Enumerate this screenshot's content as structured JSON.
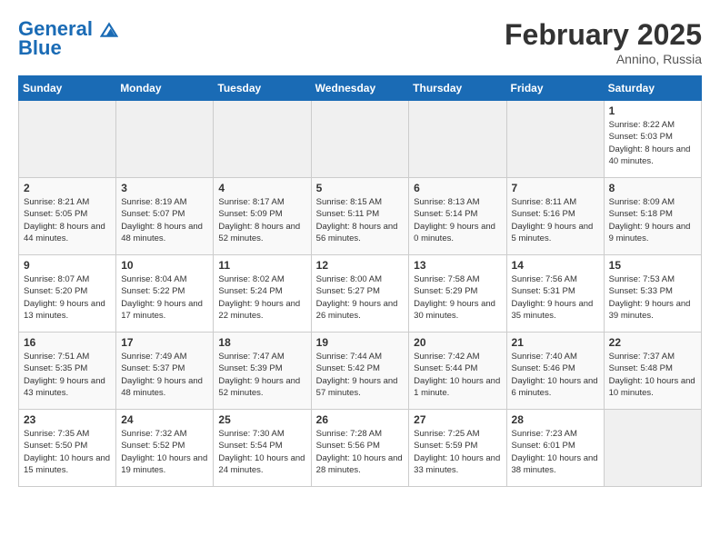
{
  "header": {
    "logo_line1": "General",
    "logo_line2": "Blue",
    "month_title": "February 2025",
    "location": "Annino, Russia"
  },
  "weekdays": [
    "Sunday",
    "Monday",
    "Tuesday",
    "Wednesday",
    "Thursday",
    "Friday",
    "Saturday"
  ],
  "weeks": [
    [
      {
        "day": "",
        "info": ""
      },
      {
        "day": "",
        "info": ""
      },
      {
        "day": "",
        "info": ""
      },
      {
        "day": "",
        "info": ""
      },
      {
        "day": "",
        "info": ""
      },
      {
        "day": "",
        "info": ""
      },
      {
        "day": "1",
        "info": "Sunrise: 8:22 AM\nSunset: 5:03 PM\nDaylight: 8 hours and 40 minutes."
      }
    ],
    [
      {
        "day": "2",
        "info": "Sunrise: 8:21 AM\nSunset: 5:05 PM\nDaylight: 8 hours and 44 minutes."
      },
      {
        "day": "3",
        "info": "Sunrise: 8:19 AM\nSunset: 5:07 PM\nDaylight: 8 hours and 48 minutes."
      },
      {
        "day": "4",
        "info": "Sunrise: 8:17 AM\nSunset: 5:09 PM\nDaylight: 8 hours and 52 minutes."
      },
      {
        "day": "5",
        "info": "Sunrise: 8:15 AM\nSunset: 5:11 PM\nDaylight: 8 hours and 56 minutes."
      },
      {
        "day": "6",
        "info": "Sunrise: 8:13 AM\nSunset: 5:14 PM\nDaylight: 9 hours and 0 minutes."
      },
      {
        "day": "7",
        "info": "Sunrise: 8:11 AM\nSunset: 5:16 PM\nDaylight: 9 hours and 5 minutes."
      },
      {
        "day": "8",
        "info": "Sunrise: 8:09 AM\nSunset: 5:18 PM\nDaylight: 9 hours and 9 minutes."
      }
    ],
    [
      {
        "day": "9",
        "info": "Sunrise: 8:07 AM\nSunset: 5:20 PM\nDaylight: 9 hours and 13 minutes."
      },
      {
        "day": "10",
        "info": "Sunrise: 8:04 AM\nSunset: 5:22 PM\nDaylight: 9 hours and 17 minutes."
      },
      {
        "day": "11",
        "info": "Sunrise: 8:02 AM\nSunset: 5:24 PM\nDaylight: 9 hours and 22 minutes."
      },
      {
        "day": "12",
        "info": "Sunrise: 8:00 AM\nSunset: 5:27 PM\nDaylight: 9 hours and 26 minutes."
      },
      {
        "day": "13",
        "info": "Sunrise: 7:58 AM\nSunset: 5:29 PM\nDaylight: 9 hours and 30 minutes."
      },
      {
        "day": "14",
        "info": "Sunrise: 7:56 AM\nSunset: 5:31 PM\nDaylight: 9 hours and 35 minutes."
      },
      {
        "day": "15",
        "info": "Sunrise: 7:53 AM\nSunset: 5:33 PM\nDaylight: 9 hours and 39 minutes."
      }
    ],
    [
      {
        "day": "16",
        "info": "Sunrise: 7:51 AM\nSunset: 5:35 PM\nDaylight: 9 hours and 43 minutes."
      },
      {
        "day": "17",
        "info": "Sunrise: 7:49 AM\nSunset: 5:37 PM\nDaylight: 9 hours and 48 minutes."
      },
      {
        "day": "18",
        "info": "Sunrise: 7:47 AM\nSunset: 5:39 PM\nDaylight: 9 hours and 52 minutes."
      },
      {
        "day": "19",
        "info": "Sunrise: 7:44 AM\nSunset: 5:42 PM\nDaylight: 9 hours and 57 minutes."
      },
      {
        "day": "20",
        "info": "Sunrise: 7:42 AM\nSunset: 5:44 PM\nDaylight: 10 hours and 1 minute."
      },
      {
        "day": "21",
        "info": "Sunrise: 7:40 AM\nSunset: 5:46 PM\nDaylight: 10 hours and 6 minutes."
      },
      {
        "day": "22",
        "info": "Sunrise: 7:37 AM\nSunset: 5:48 PM\nDaylight: 10 hours and 10 minutes."
      }
    ],
    [
      {
        "day": "23",
        "info": "Sunrise: 7:35 AM\nSunset: 5:50 PM\nDaylight: 10 hours and 15 minutes."
      },
      {
        "day": "24",
        "info": "Sunrise: 7:32 AM\nSunset: 5:52 PM\nDaylight: 10 hours and 19 minutes."
      },
      {
        "day": "25",
        "info": "Sunrise: 7:30 AM\nSunset: 5:54 PM\nDaylight: 10 hours and 24 minutes."
      },
      {
        "day": "26",
        "info": "Sunrise: 7:28 AM\nSunset: 5:56 PM\nDaylight: 10 hours and 28 minutes."
      },
      {
        "day": "27",
        "info": "Sunrise: 7:25 AM\nSunset: 5:59 PM\nDaylight: 10 hours and 33 minutes."
      },
      {
        "day": "28",
        "info": "Sunrise: 7:23 AM\nSunset: 6:01 PM\nDaylight: 10 hours and 38 minutes."
      },
      {
        "day": "",
        "info": ""
      }
    ]
  ]
}
